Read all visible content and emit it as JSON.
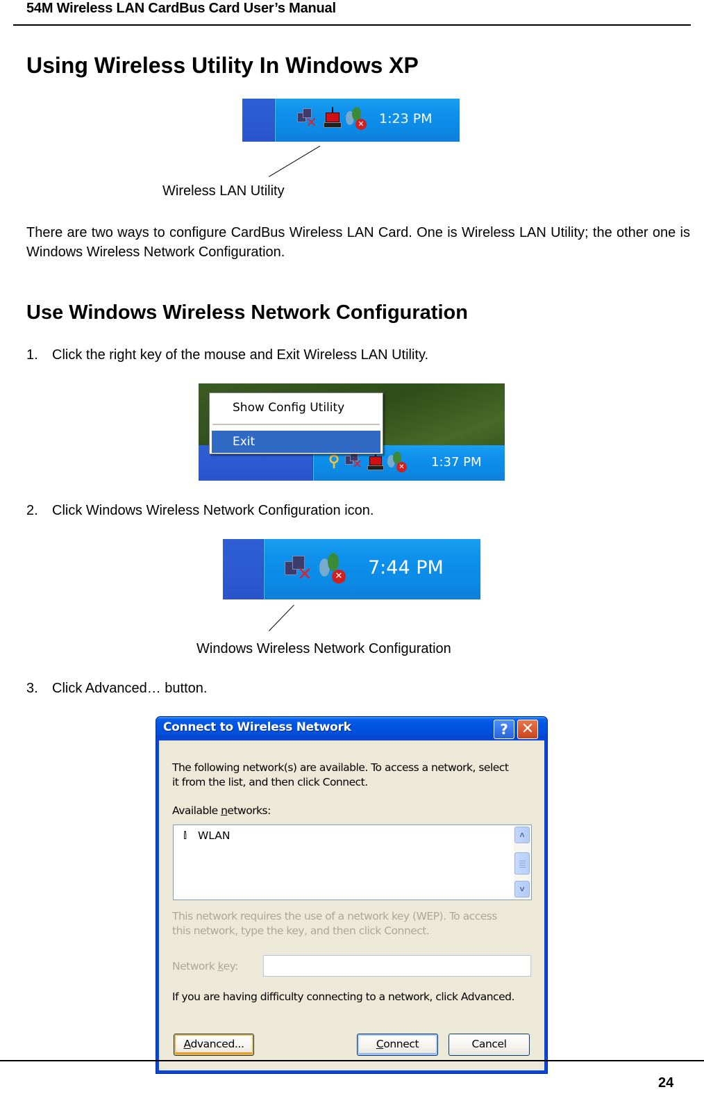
{
  "header": {
    "running_title": "54M Wireless LAN CardBus Card User’s Manual"
  },
  "section1": {
    "title": "Using Wireless Utility In Windows XP",
    "figure1": {
      "clock": "1:23 PM",
      "tray_icons": [
        "network-disconnected-icon",
        "wireless-lan-utility-icon",
        "msn-messenger-icon"
      ],
      "caption": "Wireless LAN Utility"
    },
    "paragraph": "There are two ways to configure CardBus Wireless LAN Card. One is Wireless LAN Utility; the other one is Windows Wireless Network Configuration."
  },
  "section2": {
    "title": "Use Windows Wireless Network Configuration",
    "steps": [
      {
        "num": "1.",
        "text": "Click the right key of the mouse and Exit Wireless LAN Utility."
      },
      {
        "num": "2.",
        "text": "Click Windows Wireless Network Configuration icon."
      },
      {
        "num": "3.",
        "text": "Click Advanced… button."
      }
    ],
    "figure2": {
      "menu_items": [
        {
          "label": "Show Config Utility",
          "selected": false
        },
        {
          "label": "Exit",
          "selected": true
        }
      ],
      "clock": "1:37 PM"
    },
    "figure3": {
      "clock": "7:44 PM",
      "caption": "Windows Wireless Network Configuration"
    },
    "dialog": {
      "title": "Connect to Wireless Network",
      "help_label": "?",
      "close_label": "✕",
      "intro_line1": "The following network(s) are available. To access a network, select",
      "intro_line2": "it from the list, and then click Connect.",
      "networks_label_pre": "Available ",
      "networks_label_accel": "n",
      "networks_label_post": "etworks:",
      "networks": [
        "WLAN"
      ],
      "wep_line1": "This network requires the use of a network key (WEP). To access",
      "wep_line2": "this network, type the key, and then click Connect.",
      "key_label_pre": "Network ",
      "key_label_accel": "k",
      "key_label_post": "ey:",
      "key_value": "",
      "help_text": "If you are having difficulty connecting to a network, click Advanced.",
      "buttons": {
        "advanced_accel": "A",
        "advanced_rest": "dvanced...",
        "connect_accel": "C",
        "connect_rest": "onnect",
        "cancel": "Cancel"
      }
    }
  },
  "footer": {
    "page_number": "24"
  }
}
